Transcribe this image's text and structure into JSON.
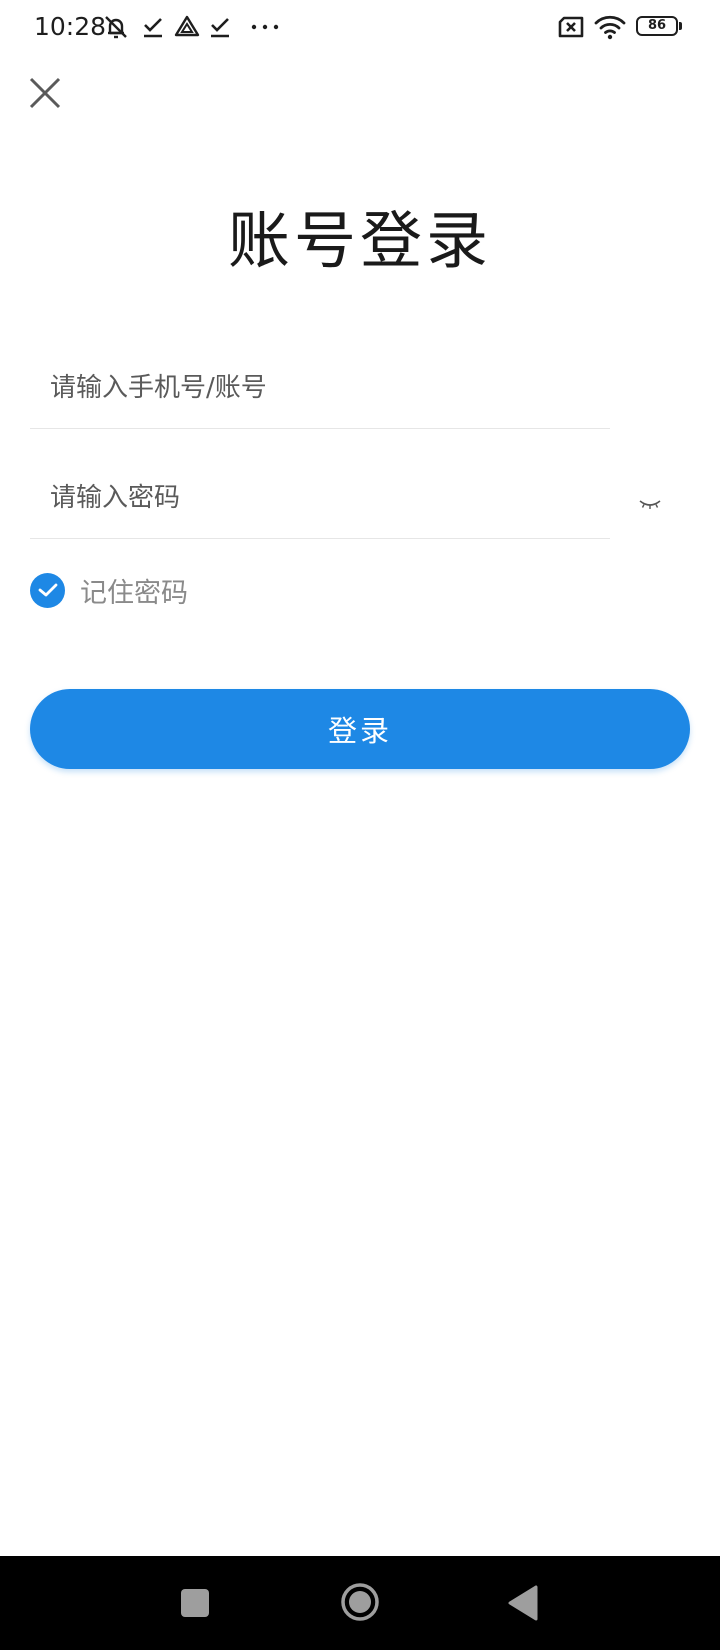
{
  "status_bar": {
    "time": "10:28",
    "battery": "86",
    "icons": [
      "bell-off-icon",
      "download-done-icon",
      "drive-icon",
      "download-done-icon",
      "more-dots-icon",
      "sim-x-icon",
      "wifi-icon",
      "battery-icon"
    ]
  },
  "header": {
    "title": "账号登录",
    "close_icon": "close-icon"
  },
  "form": {
    "account_placeholder": "请输入手机号/账号",
    "account_value": "",
    "password_placeholder": "请输入密码",
    "password_value": "",
    "password_toggle_icon": "eye-closed-icon",
    "remember_label": "记住密码",
    "remember_checked": true,
    "login_label": "登录"
  },
  "nav_bar": {
    "buttons": [
      "recent-apps-icon",
      "home-icon",
      "back-icon"
    ]
  },
  "colors": {
    "accent": "#1e88e5",
    "background": "#ffffff",
    "nav_background": "#000000"
  }
}
